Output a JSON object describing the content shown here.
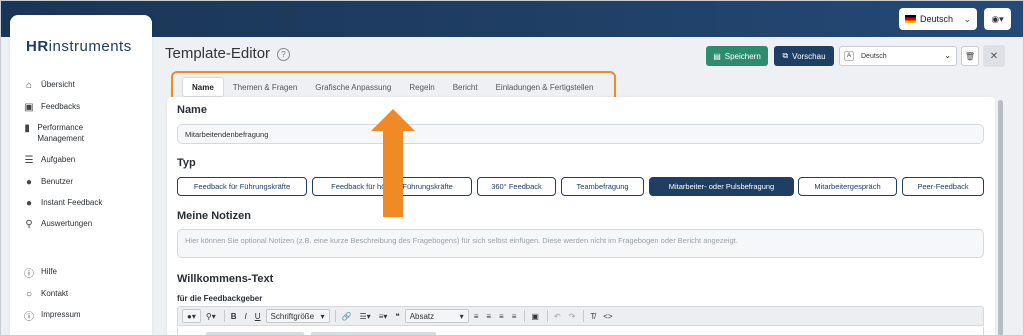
{
  "topbar": {
    "language": "Deutsch",
    "user_icon": "user-circle-icon"
  },
  "sidebar": {
    "logo_prefix": "HR",
    "logo_suffix": "instruments",
    "items": [
      {
        "label": "Übersicht",
        "icon": "house-icon"
      },
      {
        "label": "Feedbacks",
        "icon": "clipboard-icon"
      },
      {
        "label": "Performance Management",
        "icon": "chart-bars-icon"
      },
      {
        "label": "Aufgaben",
        "icon": "list-icon"
      },
      {
        "label": "Benutzer",
        "icon": "person-icon"
      },
      {
        "label": "Instant Feedback",
        "icon": "chat-icon"
      },
      {
        "label": "Auswertungen",
        "icon": "people-search-icon"
      }
    ],
    "footer_items": [
      {
        "label": "Hilfe",
        "icon": "help-circle-icon"
      },
      {
        "label": "Kontakt",
        "icon": "speech-bubble-icon"
      },
      {
        "label": "Impressum",
        "icon": "info-circle-icon"
      }
    ]
  },
  "header": {
    "title": "Template-Editor",
    "save_label": "Speichern",
    "preview_label": "Vorschau",
    "language_select": "Deutsch"
  },
  "tabs": [
    {
      "label": "Name",
      "active": true
    },
    {
      "label": "Themen & Fragen",
      "active": false
    },
    {
      "label": "Grafische Anpassung",
      "active": false
    },
    {
      "label": "Regeln",
      "active": false
    },
    {
      "label": "Bericht",
      "active": false
    },
    {
      "label": "Einladungen & Fertigstellen",
      "active": false
    }
  ],
  "form": {
    "name_title": "Name",
    "name_value": "Mitarbeitendenbefragung",
    "type_title": "Typ",
    "types": [
      {
        "label": "Feedback für Führungskräfte",
        "active": false
      },
      {
        "label": "Feedback für höhere Führungskräfte",
        "active": false
      },
      {
        "label": "360° Feedback",
        "active": false
      },
      {
        "label": "Teambefragung",
        "active": false
      },
      {
        "label": "Mitarbeiter- oder Pulsbefragung",
        "active": true
      },
      {
        "label": "Mitarbeitergespräch",
        "active": false
      },
      {
        "label": "Peer-Feedback",
        "active": false
      }
    ],
    "notes_title": "Meine Notizen",
    "notes_placeholder": "Hier können Sie optional Notizen (z.B. eine kurze Beschreibung des Fragebogens) für sich selbst einfügen. Diese werden nicht im Fragebogen oder Bericht angezeigt.",
    "welcome_title": "Willkommens-Text",
    "welcome_sub": "für die Feedbackgeber"
  },
  "toolbar": {
    "font_size_label": "Schriftgröße",
    "paragraph_label": "Absatz",
    "bold": "B",
    "italic": "I",
    "underline": "U",
    "quote": "❝",
    "source": "<>"
  },
  "colors": {
    "topbar": "#1f3e63",
    "accent_orange": "#f08a24",
    "save_green": "#2e8b6e",
    "navy": "#1f3e63"
  }
}
